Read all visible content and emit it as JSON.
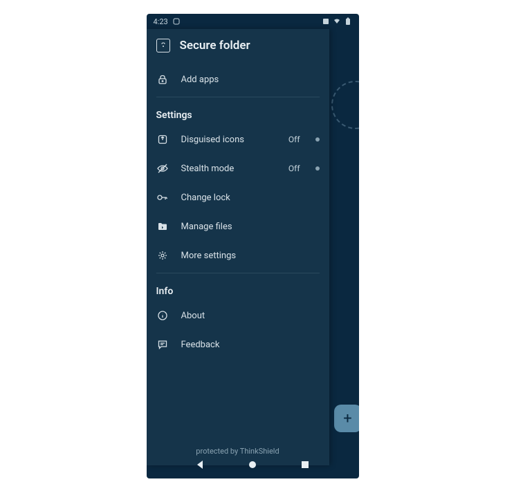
{
  "status": {
    "time": "4:23"
  },
  "drawer": {
    "title": "Secure folder",
    "add_apps_label": "Add apps",
    "settings_label": "Settings",
    "info_label": "Info",
    "footer_text": "protected by ThinkShield"
  },
  "settings": {
    "disguised_label": "Disguised icons",
    "disguised_state": "Off",
    "stealth_label": "Stealth mode",
    "stealth_state": "Off",
    "change_lock_label": "Change lock",
    "manage_files_label": "Manage files",
    "more_settings_label": "More settings"
  },
  "info": {
    "about_label": "About",
    "feedback_label": "Feedback"
  },
  "fab": {
    "symbol": "+"
  }
}
